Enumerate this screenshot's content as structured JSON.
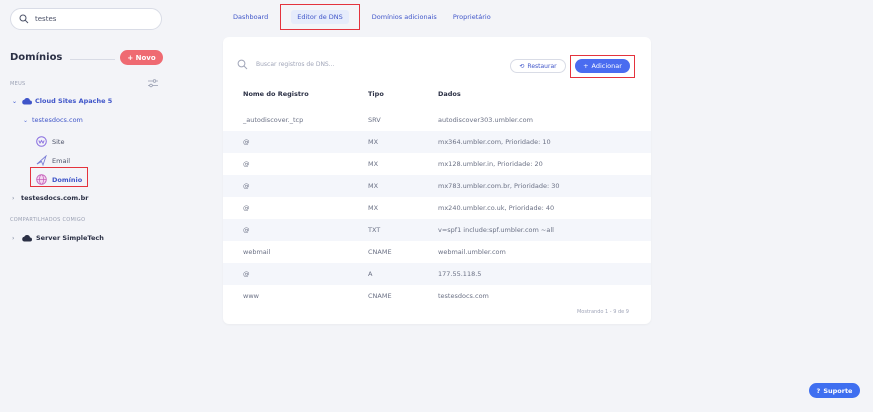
{
  "search": {
    "value": "testes"
  },
  "sidebar": {
    "title": "Domínios",
    "new_button": "+ Novo",
    "section_meus": "MEUS",
    "cloud": "Cloud Sites Apache 5",
    "domain": "testesdocs.com",
    "items": [
      "Site",
      "Email",
      "Domínio"
    ],
    "other_domain": "testesdocs.com.br",
    "section_shared": "COMPARTILHADOS COMIGO",
    "server": "Server SimpleTech"
  },
  "tabs": [
    "Dashboard",
    "Editor de DNS",
    "Domínios adicionais",
    "Proprietário"
  ],
  "dns": {
    "search_placeholder": "Buscar registros de DNS...",
    "restore_label": "Restaurar",
    "add_label": "Adicionar",
    "columns": [
      "Nome do Registro",
      "Tipo",
      "Dados"
    ],
    "rows": [
      [
        "_autodiscover._tcp",
        "SRV",
        "autodiscover303.umbler.com"
      ],
      [
        "@",
        "MX",
        "mx364.umbler.com, Prioridade: 10"
      ],
      [
        "@",
        "MX",
        "mx128.umbler.in, Prioridade: 20"
      ],
      [
        "@",
        "MX",
        "mx783.umbler.com.br, Prioridade: 30"
      ],
      [
        "@",
        "MX",
        "mx240.umbler.co.uk, Prioridade: 40"
      ],
      [
        "@",
        "TXT",
        "v=spf1 include:spf.umbler.com ~all"
      ],
      [
        "webmail",
        "CNAME",
        "webmail.umbler.com"
      ],
      [
        "@",
        "A",
        "177.55.118.5"
      ],
      [
        "www",
        "CNAME",
        "testesdocs.com"
      ]
    ],
    "footer": "Mostrando 1 - 9 de 9"
  },
  "support_label": "Suporte",
  "colors": {
    "accent": "#4a6cf0",
    "novo": "#ef6a72",
    "highlight": "#e4333d"
  }
}
